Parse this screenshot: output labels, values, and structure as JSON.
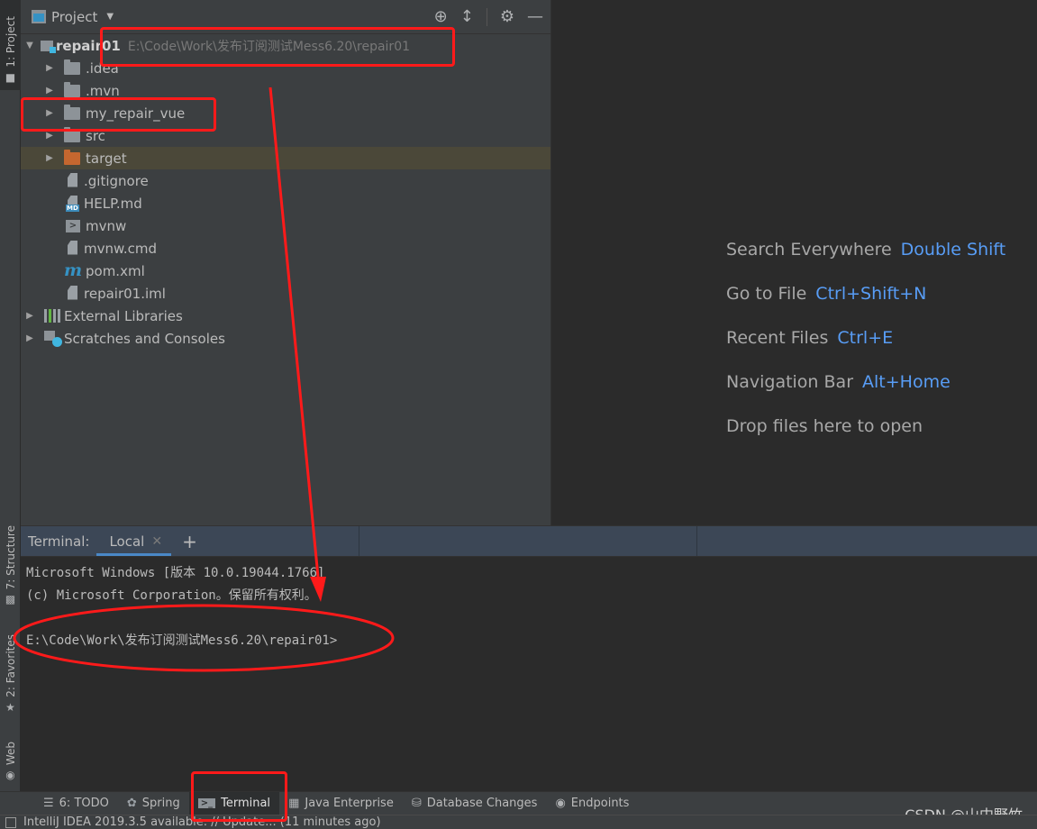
{
  "left_stripe": {
    "project": "1: Project",
    "structure": "7: Structure",
    "favorites": "2: Favorites",
    "web": "Web"
  },
  "project_panel": {
    "title": "Project",
    "root": {
      "name": "repair01",
      "path": "E:\\Code\\Work\\发布订阅测试Mess6.20\\repair01"
    },
    "items": [
      {
        "name": ".idea",
        "type": "folder"
      },
      {
        "name": ".mvn",
        "type": "folder"
      },
      {
        "name": "my_repair_vue",
        "type": "folder"
      },
      {
        "name": "src",
        "type": "folder"
      },
      {
        "name": "target",
        "type": "folder-excluded"
      },
      {
        "name": ".gitignore",
        "type": "gitignore"
      },
      {
        "name": "HELP.md",
        "type": "markdown"
      },
      {
        "name": "mvnw",
        "type": "shell"
      },
      {
        "name": "mvnw.cmd",
        "type": "text"
      },
      {
        "name": "pom.xml",
        "type": "maven"
      },
      {
        "name": "repair01.iml",
        "type": "iml"
      }
    ],
    "external_libraries": "External Libraries",
    "scratches": "Scratches and Consoles"
  },
  "editor_hints": [
    {
      "label": "Search Everywhere",
      "shortcut": "Double Shift"
    },
    {
      "label": "Go to File",
      "shortcut": "Ctrl+Shift+N"
    },
    {
      "label": "Recent Files",
      "shortcut": "Ctrl+E"
    },
    {
      "label": "Navigation Bar",
      "shortcut": "Alt+Home"
    },
    {
      "label": "Drop files here to open",
      "shortcut": ""
    }
  ],
  "terminal": {
    "label": "Terminal:",
    "tab": "Local",
    "lines": [
      "Microsoft Windows [版本 10.0.19044.1766]",
      "(c) Microsoft Corporation。保留所有权利。",
      "",
      "E:\\Code\\Work\\发布订阅测试Mess6.20\\repair01>"
    ]
  },
  "bottom_bar": [
    {
      "label": "6: TODO",
      "icon": "list-icon"
    },
    {
      "label": "Spring",
      "icon": "spring-leaf-icon"
    },
    {
      "label": "Terminal",
      "icon": "terminal-icon",
      "active": true
    },
    {
      "label": "Java Enterprise",
      "icon": "java-enterprise-icon"
    },
    {
      "label": "Database Changes",
      "icon": "database-icon"
    },
    {
      "label": "Endpoints",
      "icon": "globe-icon"
    }
  ],
  "status_bar": {
    "message": "IntelliJ IDEA 2019.3.5 available: // Update...  (11 minutes ago)"
  },
  "watermark": "CSDN @山中野竹",
  "colors": {
    "accent": "#589df6",
    "annotation": "#ff1a1a",
    "selected_row": "#4b4839"
  }
}
